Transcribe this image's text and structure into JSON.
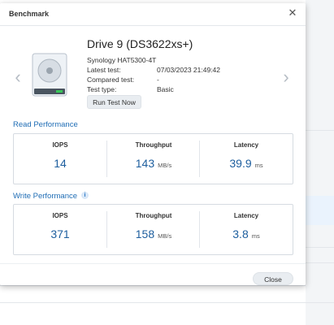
{
  "dialog": {
    "title": "Benchmark",
    "close_icon": "close-icon"
  },
  "drive": {
    "name": "Drive 9 (DS3622xs+)",
    "model": "Synology HAT5300-4T",
    "fields": [
      {
        "label": "Latest test:",
        "value": "07/03/2023 21:49:42"
      },
      {
        "label": "Compared test:",
        "value": "-"
      },
      {
        "label": "Test type:",
        "value": "Basic"
      }
    ],
    "run_button": "Run Test Now",
    "icon": "hard-drive-icon"
  },
  "navigation": {
    "prev_icon": "chevron-left-icon",
    "next_icon": "chevron-right-icon"
  },
  "read": {
    "title": "Read Performance",
    "iops": {
      "label": "IOPS",
      "value": "14"
    },
    "throughput": {
      "label": "Throughput",
      "value": "143",
      "unit": "MB/s"
    },
    "latency": {
      "label": "Latency",
      "value": "39.9",
      "unit": "ms"
    }
  },
  "write": {
    "title": "Write Performance",
    "info_icon": "info-icon",
    "iops": {
      "label": "IOPS",
      "value": "371"
    },
    "throughput": {
      "label": "Throughput",
      "value": "158",
      "unit": "MB/s"
    },
    "latency": {
      "label": "Latency",
      "value": "3.8",
      "unit": "ms"
    }
  },
  "footer": {
    "close_button": "Close"
  },
  "colors": {
    "accent": "#1f6db5",
    "value": "#1d5e9e",
    "button_bg": "#e9edf1"
  }
}
